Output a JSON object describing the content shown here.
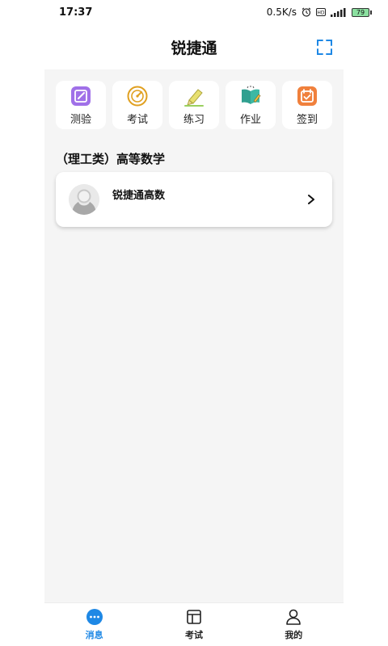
{
  "status_bar": {
    "time": "17:37",
    "network_speed": "0.5K/s",
    "battery": "79"
  },
  "header": {
    "title": "锐捷通"
  },
  "tools": [
    {
      "label": "测验",
      "icon": "quiz-icon",
      "color": "#a070e8"
    },
    {
      "label": "考试",
      "icon": "exam-target-icon",
      "color": "#e0a020"
    },
    {
      "label": "练习",
      "icon": "pencil-icon",
      "color": "#e8e070"
    },
    {
      "label": "作业",
      "icon": "book-icon",
      "color": "#30a090"
    },
    {
      "label": "签到",
      "icon": "calendar-check-icon",
      "color": "#f0803c"
    }
  ],
  "section": {
    "title": "（理工类）高等数学"
  },
  "course": {
    "name": "锐捷通高数"
  },
  "bottom_nav": [
    {
      "label": "消息",
      "icon": "message-icon",
      "active": true
    },
    {
      "label": "考试",
      "icon": "exam-icon",
      "active": false
    },
    {
      "label": "我的",
      "icon": "profile-icon",
      "active": false
    }
  ],
  "colors": {
    "accent": "#1e88e5",
    "background": "#f5f5f5"
  }
}
